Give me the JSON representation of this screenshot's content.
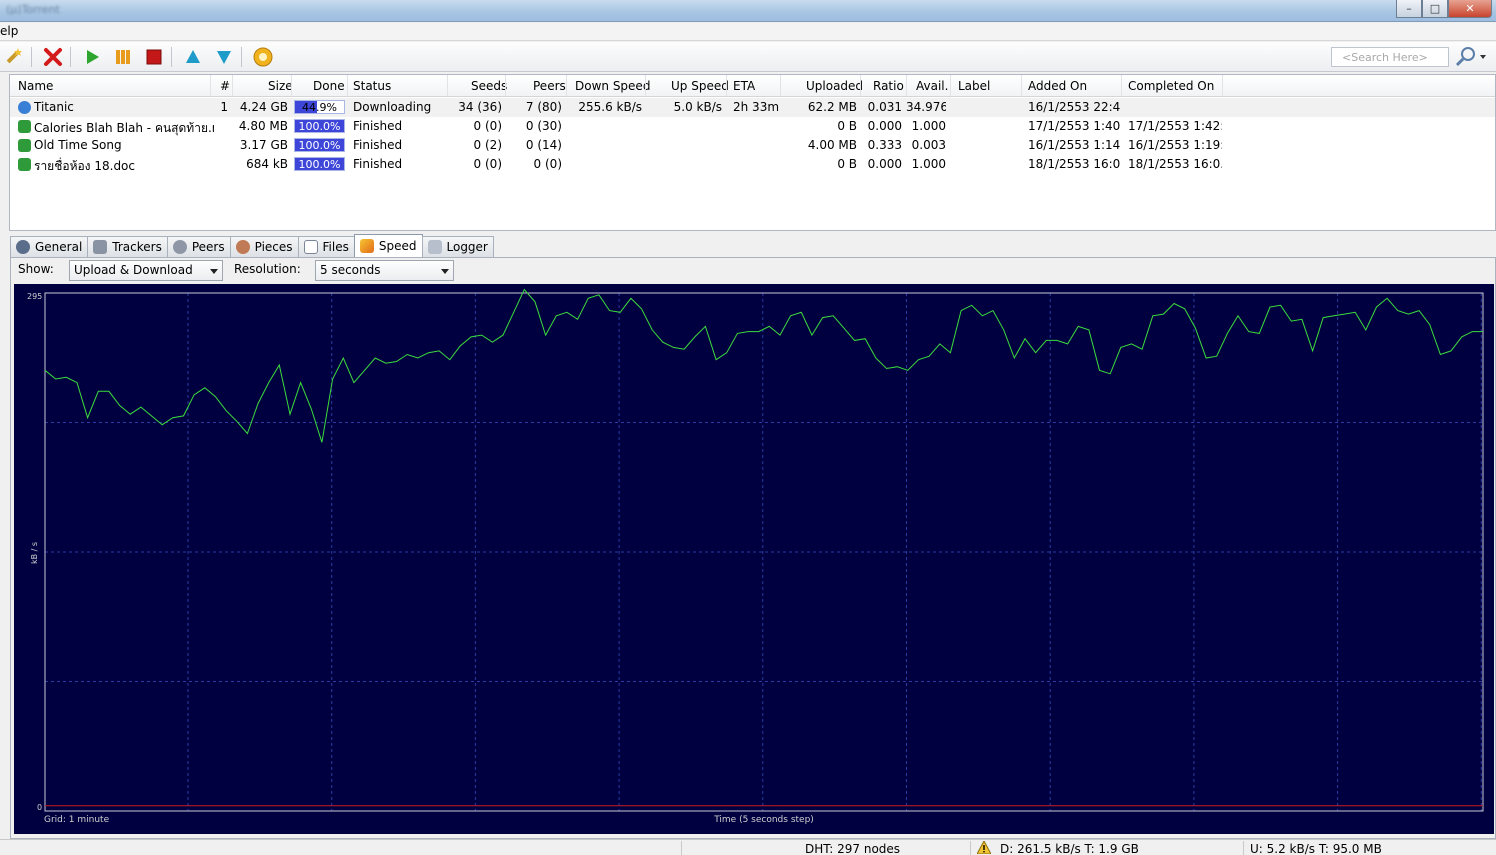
{
  "window": {
    "title": "(µ)Torrent",
    "min": "–",
    "max": "□",
    "close": "✕"
  },
  "menu": {
    "help": "elp"
  },
  "toolbar": {
    "buttons": [
      "add-torrent-wizard-icon",
      "remove-icon",
      "start-icon",
      "pause-icon",
      "stop-icon",
      "move-up-icon",
      "move-down-icon",
      "preferences-icon"
    ],
    "search_placeholder": "<Search Here>"
  },
  "columns": [
    "Name",
    "#",
    "Size",
    "Done",
    "Status",
    "Seeds",
    "Peers",
    "Down Speed",
    "Up Speed",
    "ETA",
    "Uploaded",
    "Ratio",
    "Avail.",
    "Label",
    "Added On",
    "Completed On"
  ],
  "torrents": [
    {
      "name": "Titanic",
      "num": "1",
      "size": "4.24 GB",
      "done": "44.9%",
      "done_frac": 0.449,
      "status": "Downloading",
      "seeds": "34 (36)",
      "peers": "7 (80)",
      "down": "255.6 kB/s",
      "up": "5.0 kB/s",
      "eta": "2h 33m",
      "uploaded": "62.2 MB",
      "ratio": "0.031",
      "avail": "34.976",
      "label": "",
      "added": "16/1/2553 22:4...",
      "completed": ""
    },
    {
      "name": "Calories Blah Blah - คนสุดท้าย.m...",
      "num": "",
      "size": "4.80 MB",
      "done": "100.0%",
      "done_frac": 1.0,
      "status": "Finished",
      "seeds": "0 (0)",
      "peers": "0 (30)",
      "down": "",
      "up": "",
      "eta": "",
      "uploaded": "0 B",
      "ratio": "0.000",
      "avail": "1.000",
      "label": "",
      "added": "17/1/2553 1:40:...",
      "completed": "17/1/2553 1:42:..."
    },
    {
      "name": "Old Time Song",
      "num": "",
      "size": "3.17 GB",
      "done": "100.0%",
      "done_frac": 1.0,
      "status": "Finished",
      "seeds": "0 (2)",
      "peers": "0 (14)",
      "down": "",
      "up": "",
      "eta": "",
      "uploaded": "4.00 MB",
      "ratio": "0.333",
      "avail": "0.003",
      "label": "",
      "added": "16/1/2553 1:14:...",
      "completed": "16/1/2553 1:19:..."
    },
    {
      "name": "รายชื่อห้อง 18.doc",
      "num": "",
      "size": "684 kB",
      "done": "100.0%",
      "done_frac": 1.0,
      "status": "Finished",
      "seeds": "0 (0)",
      "peers": "0 (0)",
      "down": "",
      "up": "",
      "eta": "",
      "uploaded": "0 B",
      "ratio": "0.000",
      "avail": "1.000",
      "label": "",
      "added": "18/1/2553 16:0...",
      "completed": "18/1/2553 16:0..."
    }
  ],
  "tabs": [
    {
      "label": "General",
      "icon": "info-icon"
    },
    {
      "label": "Trackers",
      "icon": "trackers-icon"
    },
    {
      "label": "Peers",
      "icon": "peers-icon"
    },
    {
      "label": "Pieces",
      "icon": "pieces-icon"
    },
    {
      "label": "Files",
      "icon": "files-icon"
    },
    {
      "label": "Speed",
      "icon": "speed-icon",
      "active": true
    },
    {
      "label": "Logger",
      "icon": "logger-icon"
    }
  ],
  "speed": {
    "show_label": "Show:",
    "show_value": "Upload & Download",
    "resolution_label": "Resolution:",
    "resolution_value": "5 seconds"
  },
  "chart_data": {
    "type": "line",
    "ylabel": "kB / s",
    "xlabel": "Time (5 seconds step)",
    "grid_label": "Grid: 1 minute",
    "ylim": [
      0,
      295
    ],
    "y_ticks": [
      "295",
      "0"
    ],
    "grid": true,
    "colors": {
      "download": "#3cdc3c",
      "upload": "#c81e1e",
      "grid": "#2a3aa0",
      "background": "#000040"
    },
    "series": [
      {
        "values": [
          251,
          246,
          247,
          244,
          224,
          239,
          239,
          231,
          226,
          230,
          225,
          220,
          224,
          225,
          237,
          241,
          236,
          228,
          222,
          215,
          232,
          244,
          254,
          226,
          244,
          229,
          210,
          246,
          258,
          244,
          251,
          258,
          255,
          256,
          260,
          258,
          261,
          262,
          257,
          265,
          270,
          271,
          267,
          271,
          284,
          297,
          290,
          271,
          282,
          284,
          280,
          292,
          294,
          285,
          284,
          292,
          286,
          274,
          267,
          264,
          263,
          270,
          276,
          257,
          261,
          272,
          273,
          273,
          276,
          271,
          282,
          284,
          271,
          281,
          282,
          275,
          268,
          269,
          258,
          252,
          253,
          251,
          257,
          259,
          266,
          261,
          285,
          288,
          282,
          285,
          274,
          258,
          269,
          261,
          268,
          268,
          266,
          276,
          274,
          251,
          249,
          264,
          266,
          263,
          282,
          283,
          289,
          286,
          275,
          258,
          259,
          272,
          282,
          273,
          272,
          287,
          288,
          279,
          280,
          262,
          281,
          282,
          283,
          284,
          274,
          287,
          292,
          285,
          283,
          285,
          277,
          260,
          262,
          270,
          273,
          273
        ]
      },
      {
        "values": [
          3,
          3,
          3,
          3,
          3,
          3,
          3,
          3,
          3,
          3,
          3,
          3,
          3,
          3,
          3,
          3,
          3,
          3,
          3,
          3,
          3,
          3,
          3,
          3,
          3,
          3,
          3,
          3,
          3,
          3,
          3,
          3,
          3,
          3,
          3,
          3,
          3,
          3,
          3,
          3,
          3,
          3,
          3,
          3,
          3,
          3,
          3,
          3,
          3,
          3,
          3,
          3,
          3,
          3,
          3,
          3,
          3,
          3,
          3,
          3,
          3,
          3,
          3,
          3,
          3,
          3,
          3,
          3,
          3,
          3,
          3,
          3,
          3,
          3,
          3,
          3,
          3,
          3,
          3,
          3,
          3,
          3,
          3,
          3,
          3,
          3,
          3,
          3,
          3,
          3,
          3,
          3,
          3,
          3,
          3,
          3,
          3,
          3,
          3,
          3,
          3,
          3,
          3,
          3,
          3,
          3,
          3,
          3,
          3,
          3,
          3,
          3,
          3,
          3,
          3,
          3,
          3,
          3,
          3,
          3,
          3,
          3,
          3,
          3,
          3,
          3,
          3,
          3,
          3,
          3,
          3,
          3,
          3,
          3,
          3,
          3
        ]
      }
    ]
  },
  "statusbar": {
    "dht": "DHT: 297 nodes",
    "down": "D: 261.5 kB/s T: 1.9 GB",
    "up": "U: 5.2 kB/s T: 95.0 MB"
  }
}
